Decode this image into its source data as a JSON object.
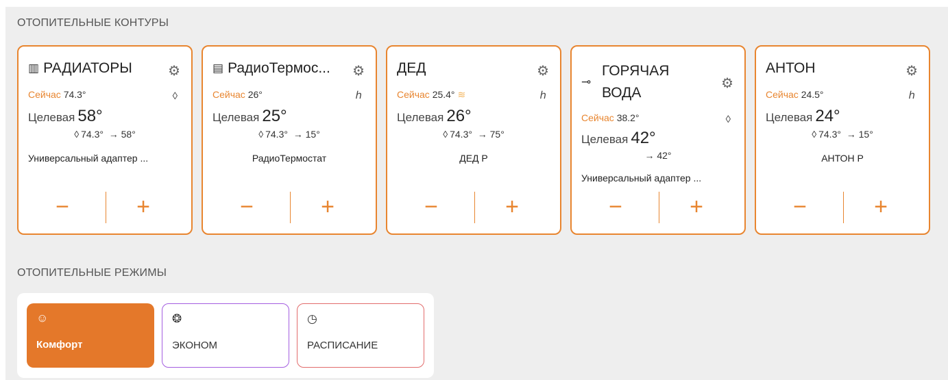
{
  "circuits_title": "ОТОПИТЕЛЬНЫЕ КОНТУРЫ",
  "modes_title": "ОТОПИТЕЛЬНЫЕ РЕЖИМЫ",
  "labels": {
    "now": "Сейчас",
    "target": "Целевая",
    "minus": "−",
    "plus": "+"
  },
  "circuits": [
    {
      "title": "РАДИАТОРЫ",
      "icon": "radiator-icon",
      "now": "74.3°",
      "target": "58°",
      "sub_drop": "74.3°",
      "sub_arrow": "→ 58°",
      "mode_icon": "drop-icon",
      "source": "Универсальный адаптер ..."
    },
    {
      "title": "РадиоТермос...",
      "icon": "thermostat-icon",
      "now": "26°",
      "target": "25°",
      "sub_drop": "74.3°",
      "sub_arrow": "→ 15°",
      "mode_icon": "schedule-mode-icon",
      "source": "РадиоТермостат"
    },
    {
      "title": "ДЕД",
      "icon": "",
      "now": "25.4°",
      "target": "26°",
      "sub_drop": "74.3°",
      "sub_arrow": "→ 75°",
      "mode_icon": "schedule-mode-icon",
      "source": "ДЕД Р",
      "heating": true
    },
    {
      "title": "ГОРЯЧАЯ ВОДА",
      "icon": "faucet-icon",
      "now": "38.2°",
      "target": "42°",
      "sub_drop": "",
      "sub_arrow": "→ 42°",
      "mode_icon": "drop-icon",
      "source": "Универсальный адаптер ..."
    },
    {
      "title": "АНТОН",
      "icon": "",
      "now": "24.5°",
      "target": "24°",
      "sub_drop": "74.3°",
      "sub_arrow": "→ 15°",
      "mode_icon": "schedule-mode-icon",
      "source": "АНТОН Р"
    }
  ],
  "modes": [
    {
      "label": "Комфорт",
      "icon": "smile-icon",
      "active": true
    },
    {
      "label": "ЭКОНОМ",
      "icon": "eco-icon",
      "active": false
    },
    {
      "label": "РАСПИСАНИЕ",
      "icon": "clock-icon",
      "active": false
    }
  ],
  "colors": {
    "accent": "#e8852f",
    "econ_border": "#a35de0",
    "schedule_border": "#e26b6b"
  }
}
